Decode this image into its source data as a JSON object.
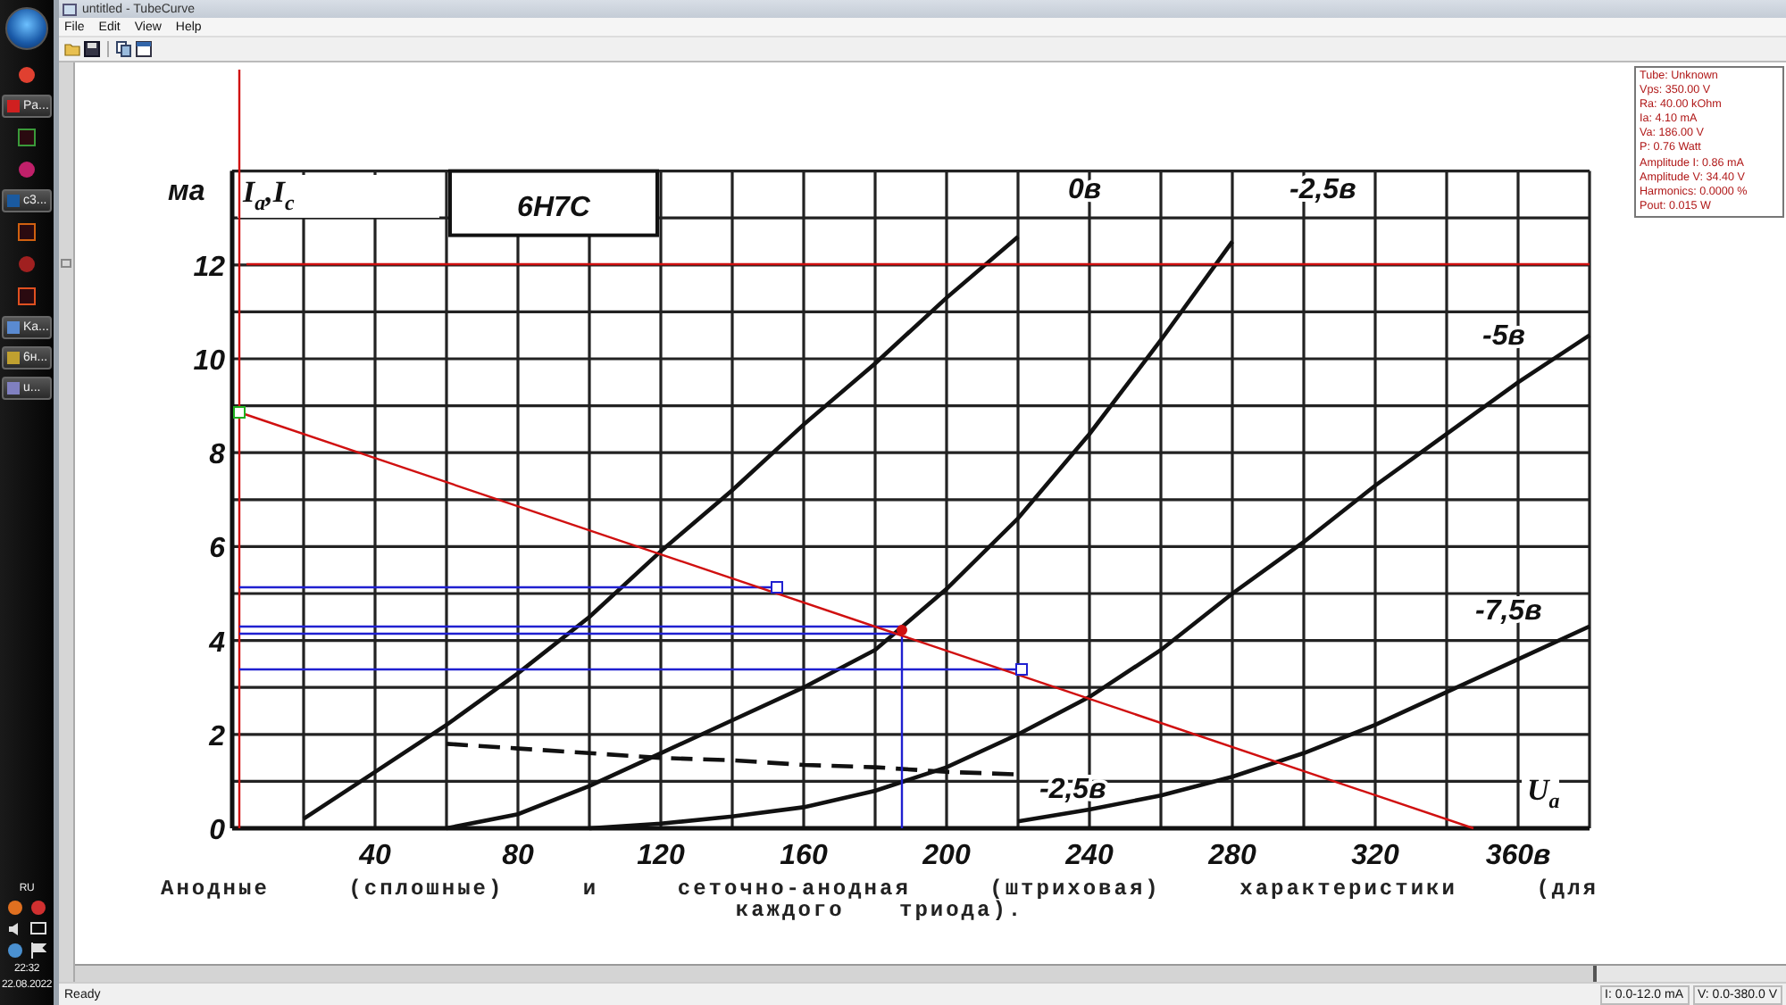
{
  "taskbar": {
    "items": [
      {
        "kind": "start"
      },
      {
        "kind": "icon"
      },
      {
        "kind": "button",
        "label": "Pa..."
      },
      {
        "kind": "icon"
      },
      {
        "kind": "icon"
      },
      {
        "kind": "button",
        "label": "c3..."
      },
      {
        "kind": "icon"
      },
      {
        "kind": "icon"
      },
      {
        "kind": "icon"
      },
      {
        "kind": "button",
        "label": "Ka..."
      },
      {
        "kind": "button",
        "label": "6н..."
      },
      {
        "kind": "button",
        "label": "u..."
      }
    ],
    "tray": {
      "language": "RU",
      "time": "22:32",
      "date": "22.08.2022"
    }
  },
  "window": {
    "title": "untitled - TubeCurve"
  },
  "menu": [
    "File",
    "Edit",
    "View",
    "Help"
  ],
  "graph": {
    "unit_label": "ма",
    "axis_label": "I$_{а}$,I$_{с}$",
    "tube": "6Н7С",
    "x_axis_label": "U$_{а}$",
    "chart_data": {
      "type": "line",
      "grid": true,
      "x": [
        20,
        40,
        60,
        80,
        100,
        120,
        140,
        160,
        180,
        200,
        220,
        240,
        260,
        280,
        300,
        320,
        340,
        360,
        380
      ],
      "xlim": [
        0,
        380
      ],
      "ylim": [
        0,
        14
      ],
      "xticks": [
        40,
        80,
        120,
        160,
        200,
        240,
        280,
        320,
        {
          "value": 360,
          "label": "360в"
        }
      ],
      "yticks": [
        0,
        2,
        4,
        6,
        8,
        10,
        12
      ],
      "series": [
        {
          "name": "0в",
          "color": "#111111",
          "values": [
            0.2,
            1.2,
            2.2,
            3.3,
            4.5,
            5.9,
            7.2,
            8.6,
            9.9,
            11.3,
            12.6,
            null,
            null,
            null,
            null,
            null,
            null,
            null,
            null
          ]
        },
        {
          "name": "-2,5в",
          "color": "#111111",
          "values": [
            null,
            null,
            0,
            0.3,
            0.9,
            1.6,
            2.3,
            3.0,
            3.8,
            5.1,
            6.6,
            8.4,
            10.4,
            12.5,
            null,
            null,
            null,
            null,
            null
          ]
        },
        {
          "name": "-5в",
          "color": "#111111",
          "values": [
            null,
            null,
            null,
            null,
            0,
            0.1,
            0.25,
            0.45,
            0.8,
            1.3,
            2.0,
            2.8,
            3.8,
            5.0,
            6.1,
            7.3,
            8.4,
            9.5,
            10.5
          ]
        },
        {
          "name": "-7,5в",
          "color": "#111111",
          "values": [
            null,
            null,
            null,
            null,
            null,
            null,
            null,
            null,
            null,
            null,
            0.15,
            0.4,
            0.7,
            1.1,
            1.6,
            2.2,
            2.9,
            3.6,
            4.3
          ]
        },
        {
          "name": "-2,5в",
          "color": "#111111",
          "line_style": "dashed",
          "values": [
            null,
            null,
            1.8,
            1.7,
            1.6,
            1.5,
            1.45,
            1.35,
            1.3,
            1.2,
            1.15,
            null,
            null,
            null,
            null,
            null,
            null,
            null,
            null
          ]
        }
      ]
    },
    "caption": "Анодные (сплошные) и сеточно-анодная (штриховая) характеристики (для каждого триода)."
  },
  "info_panel": [
    "Tube: Unknown",
    "Vps: 350.00 V",
    "Ra: 40.00 kOhm",
    "Ia: 4.10 mA",
    "Va: 186.00 V",
    "P: 0.76 Watt",
    "Amplitude I: 0.86 mA",
    "Amplitude V: 34.40 V",
    "Harmonics: 0.0000 %",
    "Pout: 0.015 W"
  ],
  "status_bar": {
    "message": "Ready",
    "fields": [
      "I: 0.0-12.0 mA",
      "V: 0.0-380.0 V"
    ]
  }
}
